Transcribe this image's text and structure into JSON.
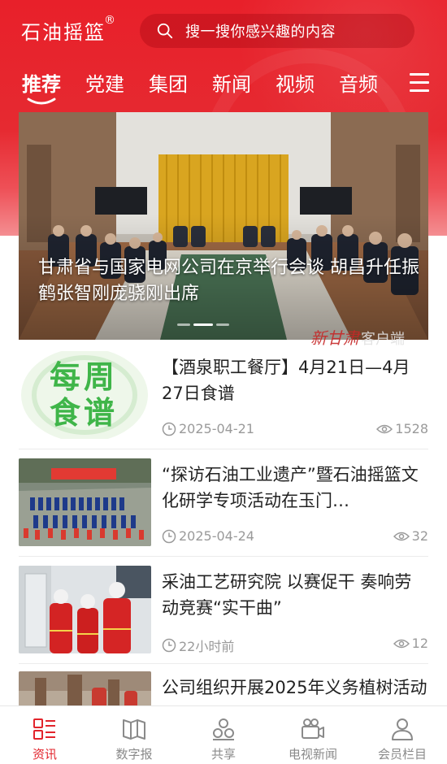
{
  "app": {
    "brand": "石油摇篮",
    "brand_mark": "®"
  },
  "search": {
    "placeholder": "搜一搜你感兴趣的内容",
    "icon": "search-icon"
  },
  "tabs": [
    {
      "label": "推荐",
      "active": true
    },
    {
      "label": "党建",
      "active": false
    },
    {
      "label": "集团",
      "active": false
    },
    {
      "label": "新闻",
      "active": false
    },
    {
      "label": "视频",
      "active": false
    },
    {
      "label": "音频",
      "active": false
    }
  ],
  "hero": {
    "title": "甘肃省与国家电网公司在京举行会谈 胡昌升任振鹤张智刚庞骁刚出席",
    "watermark_script": "新甘肃",
    "watermark_suffix": "客户端",
    "slide_count": 3,
    "active_slide": 2
  },
  "news": [
    {
      "title": "【酒泉职工餐厅】4月21日—4月27日食谱",
      "thumb_text": [
        "每",
        "周",
        "食",
        "谱"
      ],
      "date": "2025-04-21",
      "views": "1528"
    },
    {
      "title": "“探访石油工业遗产”暨石油摇篮文化研学专项活动在玉门…",
      "date": "2025-04-24",
      "views": "32"
    },
    {
      "title": "采油工艺研究院  以赛促干 奏响劳动竞赛“实干曲”",
      "date": "22小时前",
      "views": "12"
    },
    {
      "title": "公司组织开展2025年义务植树活动"
    }
  ],
  "bottom_nav": [
    {
      "label": "资讯",
      "icon": "news-icon",
      "active": true
    },
    {
      "label": "数字报",
      "icon": "newspaper-icon",
      "active": false
    },
    {
      "label": "共享",
      "icon": "share-icon",
      "active": false
    },
    {
      "label": "电视新闻",
      "icon": "camera-icon",
      "active": false
    },
    {
      "label": "会员栏目",
      "icon": "user-icon",
      "active": false
    }
  ],
  "colors": {
    "brand_red": "#e2242c",
    "text_dark": "#222222",
    "text_muted": "#9a9a9a"
  }
}
